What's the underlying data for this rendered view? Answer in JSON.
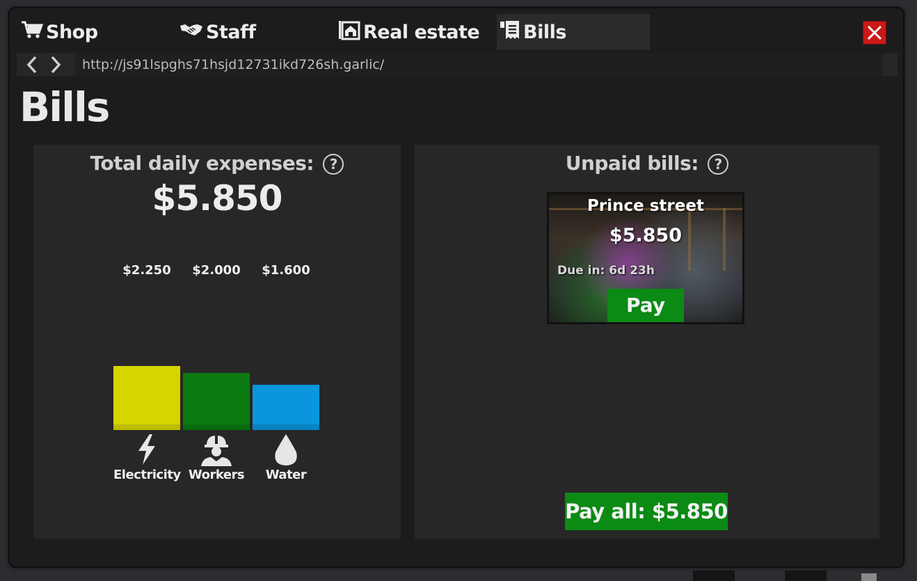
{
  "tabs": [
    {
      "label": "Shop",
      "icon": "cart-icon"
    },
    {
      "label": "Staff",
      "icon": "handshake-icon"
    },
    {
      "label": "Real estate",
      "icon": "building-icon"
    },
    {
      "label": "Bills",
      "icon": "receipt-icon",
      "active": true
    }
  ],
  "browser": {
    "url": "http://js91lspghs71hsjd12731ikd726sh.garlic/"
  },
  "page": {
    "title": "Bills"
  },
  "expenses": {
    "heading": "Total daily expenses:",
    "help": "?",
    "total": "$5.850"
  },
  "chart_data": {
    "type": "bar",
    "categories": [
      "Electricity",
      "Workers",
      "Water"
    ],
    "values": [
      2250,
      2000,
      1600
    ],
    "value_labels": [
      "$2.250",
      "$2.000",
      "$1.600"
    ],
    "colors": [
      "#d6d500",
      "#0b7a12",
      "#0a96dc"
    ],
    "icons": [
      "lightning-icon",
      "worker-helmet-icon",
      "water-drop-icon"
    ]
  },
  "unpaid": {
    "heading": "Unpaid bills:",
    "help": "?",
    "bills": [
      {
        "name": "Prince street",
        "amount": "$5.850",
        "due": "Due in: 6d 23h",
        "pay_label": "Pay"
      }
    ],
    "pay_all_label": "Pay all: $5.850"
  },
  "colors": {
    "pay_green": "#0b8a14",
    "close_red": "#c91818"
  }
}
